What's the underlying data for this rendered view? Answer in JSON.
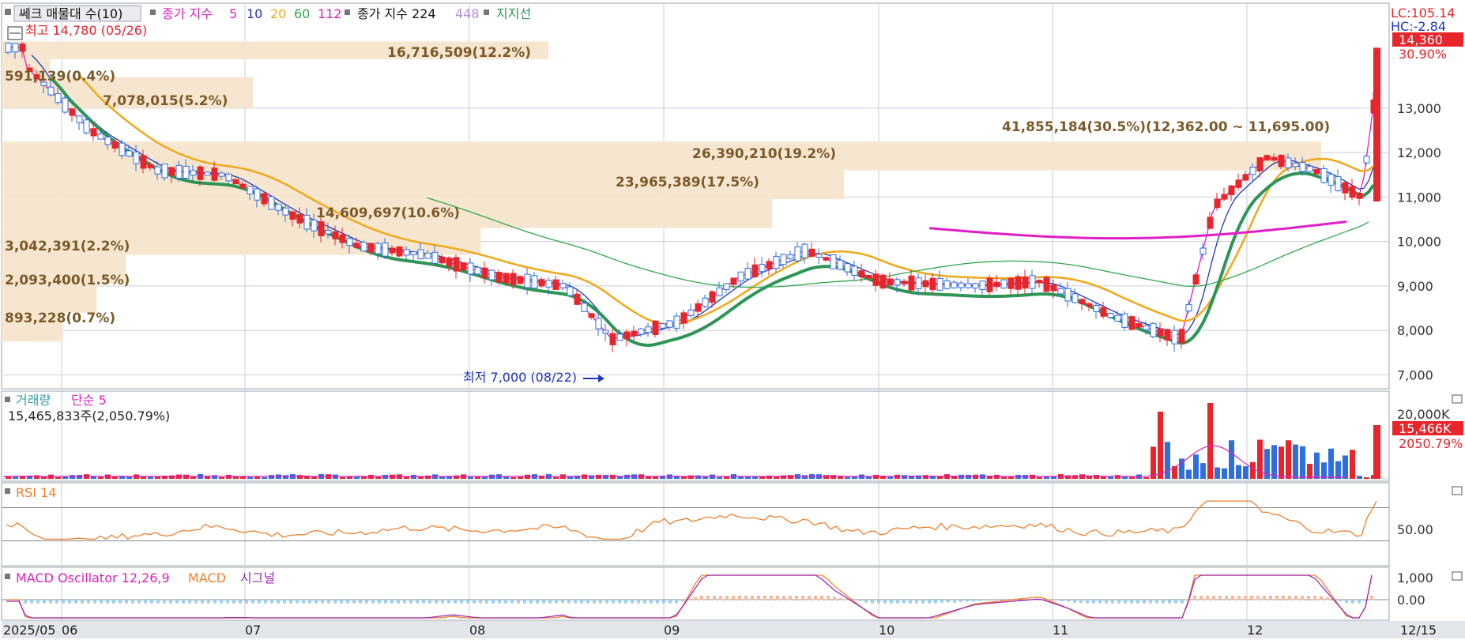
{
  "colors": {
    "up": "#e8252b",
    "down": "#2f6ee0",
    "ma5": "#e01fc0",
    "ma10": "#1f36b8",
    "ma20": "#f0a81b",
    "ma60": "#2ea84a",
    "ma112": "#2e9556",
    "ma224": "#e01fc8",
    "profile": "#f7e6cf",
    "profileText": "#7a5a2a",
    "rsi": "#f07f2f",
    "macd": "#f07f2f",
    "signal": "#9b2bb0",
    "grid": "#c8ced8",
    "axisText": "#333333",
    "highlight": "#e8252b"
  },
  "header": {
    "menu_label": "쎄크 매물대 수(10)",
    "ma_label_prefix": "종가 지수",
    "ma_periods": [
      "5",
      "10",
      "20",
      "60",
      "112"
    ],
    "ma224_label": "종가 지수 224",
    "ma448_label": "448",
    "support_label": "지지선"
  },
  "price_axis": {
    "ticks": [
      "13,000",
      "12,000",
      "11,000",
      "10,000",
      "9,000",
      "8,000",
      "7,000"
    ],
    "lc_label": "LC:105.14",
    "hc_label": "HC:-2.84",
    "current_price": "14,360",
    "current_change": "30.90%"
  },
  "annotations": {
    "max_label": "최고 14,780 (05/26)",
    "min_label": "최저 7,000 (08/22)"
  },
  "profile_labels": [
    "16,716,509(12.2%)",
    "591,139(0.4%)",
    "7,078,015(5.2%)",
    "41,855,184(30.5%)(12,362.00 ~ 11,695.00)",
    "26,390,210(19.2%)",
    "23,965,389(17.5%)",
    "14,609,697(10.6%)",
    "3,042,391(2.2%)",
    "2,093,400(1.5%)",
    "893,228(0.7%)"
  ],
  "volume_panel": {
    "title": "거래량",
    "ma_label": "단순 5",
    "info": "15,465,833주(2,050.79%)",
    "ticks": [
      "20,000K"
    ],
    "current_value": "15,466K",
    "current_pct": "2050.79%"
  },
  "rsi_panel": {
    "title": "RSI 14",
    "ticks": [
      "50.00"
    ]
  },
  "macd_panel": {
    "title": "MACD Oscillator 12,26,9",
    "macd_label": "MACD",
    "signal_label": "시그널",
    "ticks": [
      "1,000",
      "0.00"
    ]
  },
  "date_axis": {
    "labels": [
      "2025/05",
      "06",
      "07",
      "08",
      "09",
      "10",
      "11",
      "12",
      "12/15"
    ]
  },
  "chart_data": {
    "type": "candlestick",
    "x_range": [
      "2025-05-23",
      "2025-12-15"
    ],
    "y_range": [
      7000,
      14780
    ],
    "high": {
      "value": 14780,
      "date": "05/26"
    },
    "low": {
      "value": 7000,
      "date": "08/22"
    },
    "close_points": [
      {
        "x": "2025-05-26",
        "y": 14000
      },
      {
        "x": "2025-06-05",
        "y": 12500
      },
      {
        "x": "2025-06-15",
        "y": 11600
      },
      {
        "x": "2025-06-25",
        "y": 11500
      },
      {
        "x": "2025-07-05",
        "y": 10600
      },
      {
        "x": "2025-07-15",
        "y": 9900
      },
      {
        "x": "2025-07-25",
        "y": 9700
      },
      {
        "x": "2025-08-05",
        "y": 9200
      },
      {
        "x": "2025-08-15",
        "y": 9000
      },
      {
        "x": "2025-08-22",
        "y": 7800
      },
      {
        "x": "2025-09-01",
        "y": 8200
      },
      {
        "x": "2025-09-10",
        "y": 9200
      },
      {
        "x": "2025-09-20",
        "y": 9800
      },
      {
        "x": "2025-10-01",
        "y": 9100
      },
      {
        "x": "2025-10-15",
        "y": 9000
      },
      {
        "x": "2025-10-25",
        "y": 9100
      },
      {
        "x": "2025-11-05",
        "y": 8300
      },
      {
        "x": "2025-11-15",
        "y": 7800
      },
      {
        "x": "2025-11-20",
        "y": 10800
      },
      {
        "x": "2025-11-28",
        "y": 11900
      },
      {
        "x": "2025-12-05",
        "y": 11600
      },
      {
        "x": "2025-12-12",
        "y": 11000
      },
      {
        "x": "2025-12-15",
        "y": 14360
      }
    ],
    "volume_profile": [
      {
        "volume": 16716509,
        "pct": 12.2
      },
      {
        "volume": 591139,
        "pct": 0.4
      },
      {
        "volume": 7078015,
        "pct": 5.2
      },
      {
        "volume": 41855184,
        "pct": 30.5
      },
      {
        "volume": 26390210,
        "pct": 19.2
      },
      {
        "volume": 23965389,
        "pct": 17.5
      },
      {
        "volume": 14609697,
        "pct": 10.6
      },
      {
        "volume": 3042391,
        "pct": 2.2
      },
      {
        "volume": 2093400,
        "pct": 1.5
      },
      {
        "volume": 893228,
        "pct": 0.7
      }
    ],
    "last_volume": 15465833,
    "rsi_reference": 50,
    "macd_reference": 0
  }
}
